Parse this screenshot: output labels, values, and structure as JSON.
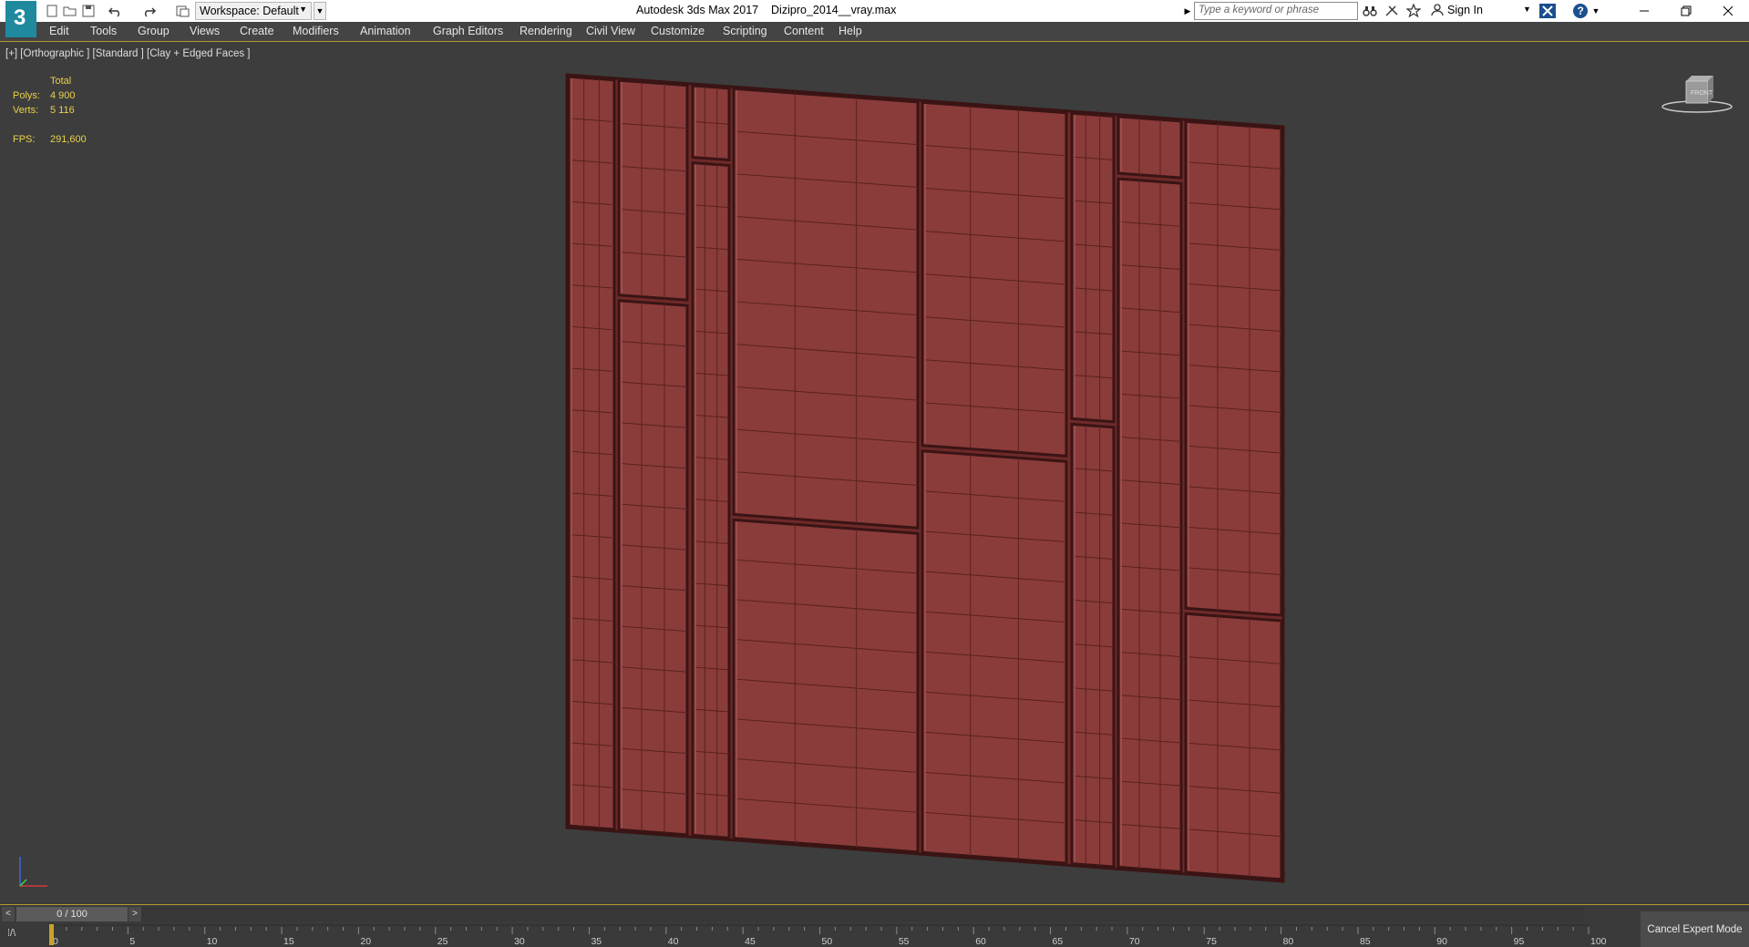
{
  "app": {
    "logo_text": "3",
    "title": "Autodesk 3ds Max 2017",
    "file": "Dizipro_2014__vray.max"
  },
  "quick_access": {
    "icons": [
      "new-file-icon",
      "open-file-icon",
      "save-icon",
      "undo-icon",
      "redo-icon",
      "project-folder-icon"
    ],
    "workspace_label": "Workspace: Default"
  },
  "infocenter": {
    "search_placeholder": "Type a keyword or phrase",
    "signin_label": "Sign In"
  },
  "menu": {
    "items": [
      "Edit",
      "Tools",
      "Group",
      "Views",
      "Create",
      "Modifiers",
      "Animation",
      "Graph Editors",
      "Rendering",
      "Civil View",
      "Customize",
      "Scripting",
      "Content",
      "Help"
    ]
  },
  "viewport": {
    "label": "[+] [Orthographic ] [Standard ] [Clay + Edged Faces ]",
    "stats": {
      "header": "Total",
      "polys_label": "Polys:",
      "polys_value": "4 900",
      "verts_label": "Verts:",
      "verts_value": "5 116",
      "fps_label": "FPS:",
      "fps_value": "291,600"
    },
    "viewcube_label": "FRONT"
  },
  "timeline": {
    "current": "0 / 100",
    "ticks": [
      "0",
      "5",
      "10",
      "15",
      "20",
      "25",
      "30",
      "35",
      "40",
      "45",
      "50",
      "55",
      "60",
      "65",
      "70",
      "75",
      "80",
      "85",
      "90",
      "95",
      "100"
    ]
  },
  "status": {
    "cancel_expert_label": "Cancel Expert Mode"
  },
  "colors": {
    "accent": "#b59b2d",
    "stats_text": "#e8d24a",
    "clay": "#8a3c3a",
    "edge": "#3a1414"
  }
}
